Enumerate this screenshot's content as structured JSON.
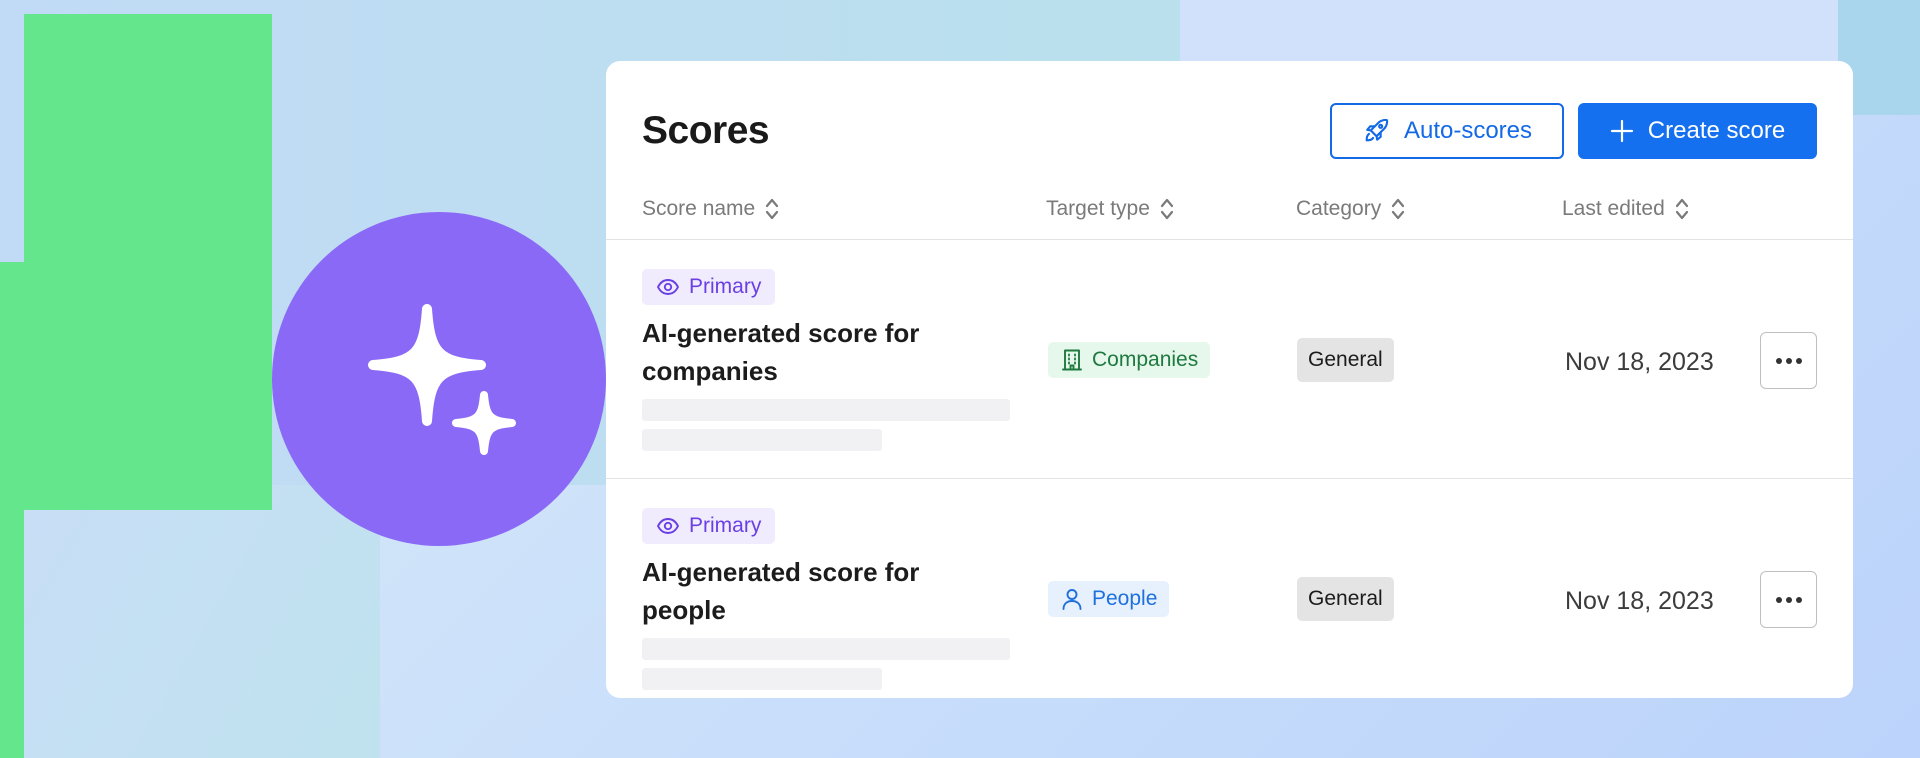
{
  "colors": {
    "accent": "#1570ef",
    "sparkle_bg": "#8b69f7",
    "decor_green": "#64e68c"
  },
  "header": {
    "title": "Scores",
    "auto_scores_label": "Auto-scores",
    "auto_scores_icon": "rocket-icon",
    "create_score_label": "Create score",
    "create_score_icon": "plus-icon"
  },
  "columns": [
    {
      "label": "Score name"
    },
    {
      "label": "Target type"
    },
    {
      "label": "Category"
    },
    {
      "label": "Last edited"
    }
  ],
  "rows": [
    {
      "badge": "Primary",
      "badge_icon": "eye-icon",
      "name": "AI-generated score for companies",
      "target": "Companies",
      "target_icon": "building-icon",
      "category": "General",
      "last_edited": "Nov 18, 2023"
    },
    {
      "badge": "Primary",
      "badge_icon": "eye-icon",
      "name": "AI-generated score for people",
      "target": "People",
      "target_icon": "person-icon",
      "category": "General",
      "last_edited": "Nov 18, 2023"
    }
  ]
}
